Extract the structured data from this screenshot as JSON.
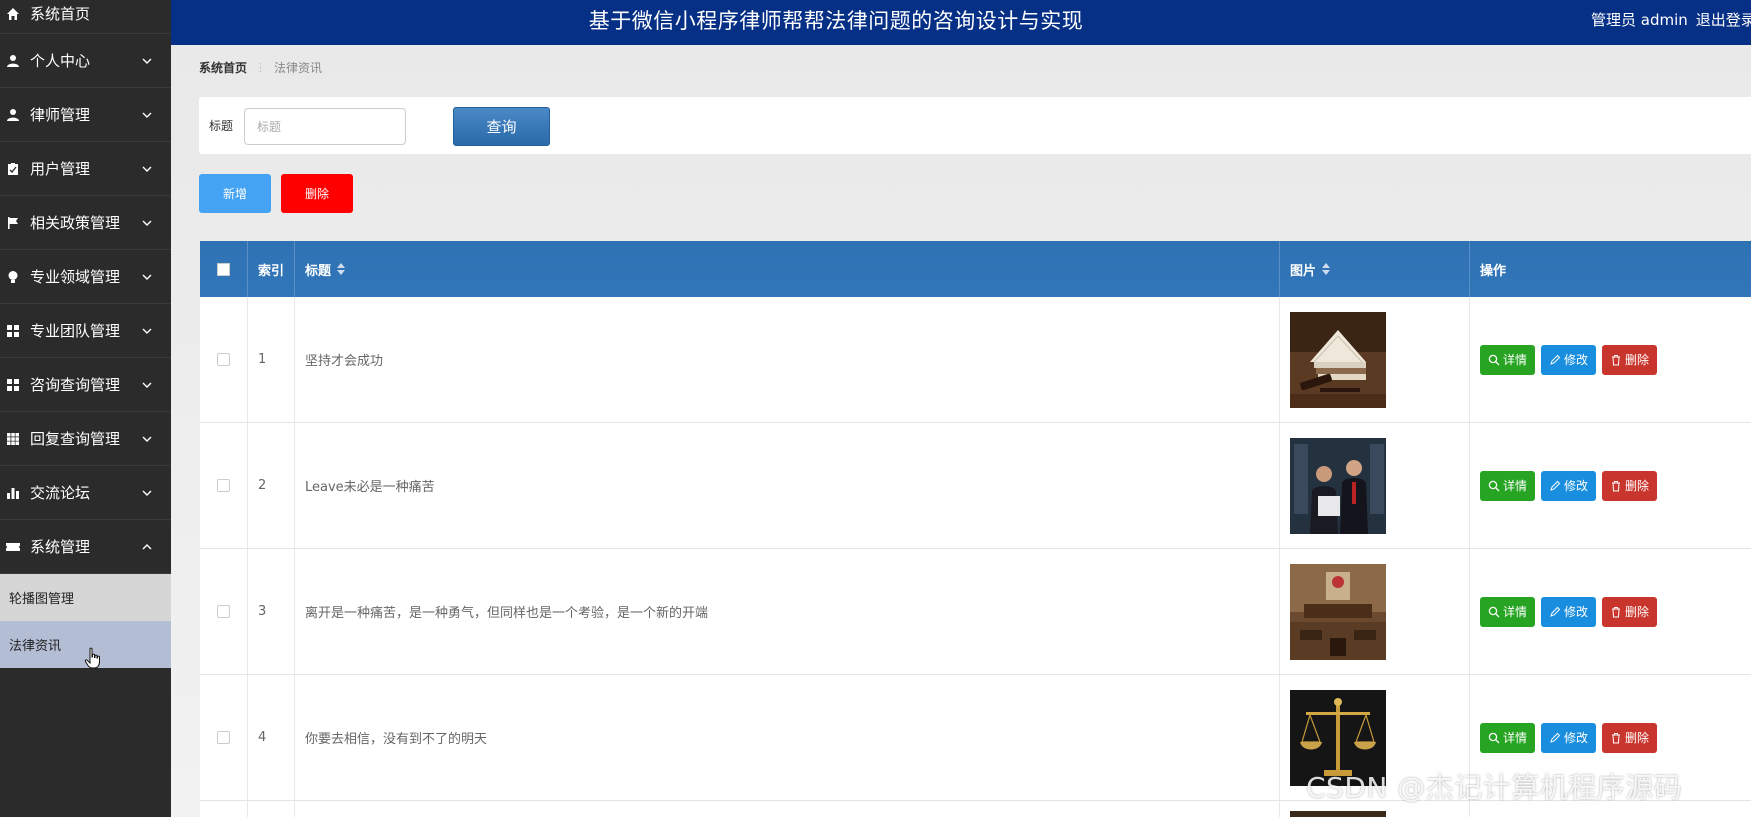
{
  "header": {
    "title": "基于微信小程序律师帮帮法律问题的咨询设计与实现",
    "user_label": "管理员 admin",
    "logout_label": "退出登录"
  },
  "sidebar": {
    "items": [
      {
        "label": "系统首页",
        "icon": "home-icon"
      },
      {
        "label": "个人中心",
        "icon": "user-icon"
      },
      {
        "label": "律师管理",
        "icon": "user-icon"
      },
      {
        "label": "用户管理",
        "icon": "clipboard-icon"
      },
      {
        "label": "相关政策管理",
        "icon": "flag-icon"
      },
      {
        "label": "专业领域管理",
        "icon": "bulb-icon"
      },
      {
        "label": "专业团队管理",
        "icon": "grid-icon"
      },
      {
        "label": "咨询查询管理",
        "icon": "grid-icon"
      },
      {
        "label": "回复查询管理",
        "icon": "table-icon"
      },
      {
        "label": "交流论坛",
        "icon": "bar-chart-icon"
      },
      {
        "label": "系统管理",
        "icon": "ticket-icon"
      }
    ],
    "sub_items": [
      {
        "label": "轮播图管理"
      },
      {
        "label": "法律资讯"
      }
    ]
  },
  "breadcrumb": {
    "home": "系统首页",
    "current": "法律资讯"
  },
  "search": {
    "label": "标题",
    "placeholder": "标题",
    "button": "查询"
  },
  "actions": {
    "add": "新增",
    "delete": "删除"
  },
  "table": {
    "columns": [
      "索引",
      "标题",
      "图片",
      "操作"
    ],
    "rows": [
      {
        "index": "1",
        "title": "坚持才会成功",
        "image": "books-gavel"
      },
      {
        "index": "2",
        "title": "Leave未必是一种痛苦",
        "image": "lawyers"
      },
      {
        "index": "3",
        "title": "离开是一种痛苦，是一种勇气，但同样也是一个考验，是一个新的开端",
        "image": "courtroom"
      },
      {
        "index": "4",
        "title": "你要去相信，没有到不了的明天",
        "image": "scales"
      }
    ],
    "ops": {
      "detail": "详情",
      "edit": "修改",
      "remove": "删除"
    }
  },
  "watermark": "CSDN @杰记计算机程序源码",
  "colors": {
    "header": "#062f86",
    "sidebar": "#2b2b2b",
    "table_head": "#2f72b4",
    "detail": "#26a422",
    "edit": "#1a8ede",
    "remove": "#c7352c",
    "add": "#45a3f4",
    "delete": "#ff0000"
  }
}
